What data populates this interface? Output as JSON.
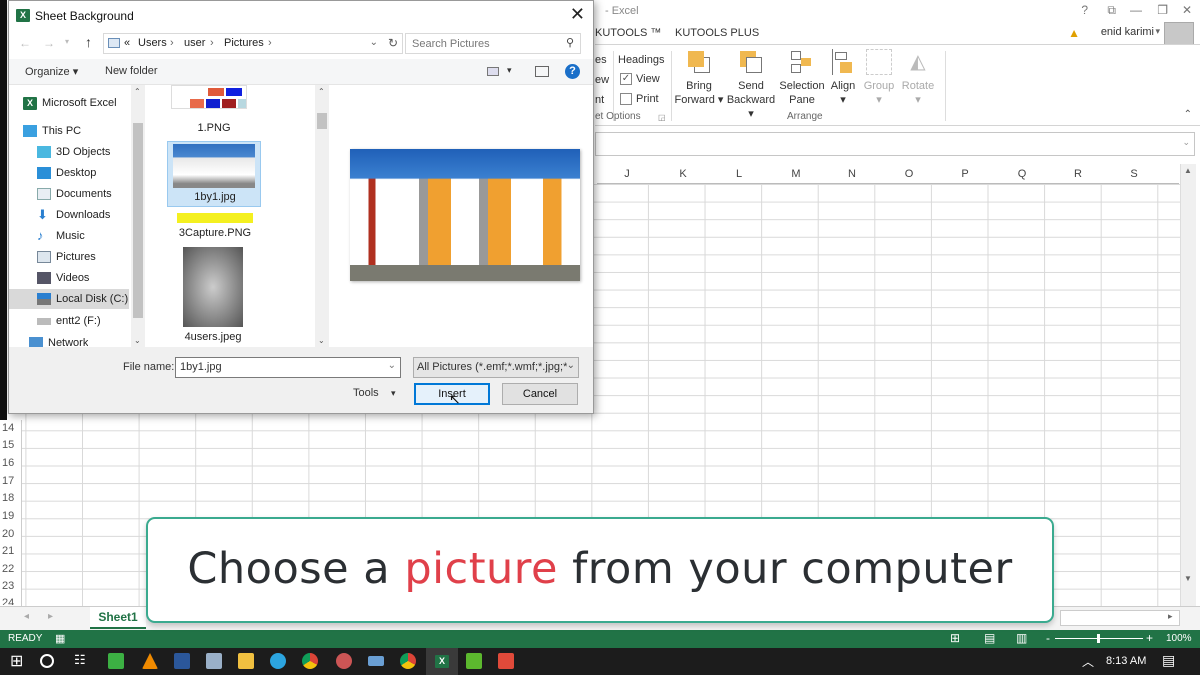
{
  "excel": {
    "window_title": "- Excel",
    "window_controls": [
      "?",
      "⧉",
      "—",
      "❐",
      "✕"
    ],
    "tabs": [
      "KUTOOLS ™",
      "KUTOOLS PLUS"
    ],
    "user": "enid karimi",
    "ribbon": {
      "sheet_options_partial": [
        "es",
        "ew",
        "nt"
      ],
      "headings_label": "Headings",
      "view_label": "View",
      "view_checked": true,
      "print_label": "Print",
      "print_checked": false,
      "sheet_options_group": "et Options",
      "arrange_group": "Arrange",
      "buttons": [
        {
          "line1": "Bring",
          "line2": "Forward ▾",
          "enabled": true
        },
        {
          "line1": "Send",
          "line2": "Backward ▾",
          "enabled": true
        },
        {
          "line1": "Selection",
          "line2": "Pane",
          "enabled": true
        },
        {
          "line1": "Align",
          "line2": "▾",
          "enabled": true
        },
        {
          "line1": "Group",
          "line2": "▾",
          "enabled": false
        },
        {
          "line1": "Rotate",
          "line2": "▾",
          "enabled": false
        }
      ]
    },
    "columns": [
      "J",
      "K",
      "L",
      "M",
      "N",
      "O",
      "P",
      "Q",
      "R",
      "S"
    ],
    "rows": [
      "14",
      "15",
      "16",
      "17",
      "18",
      "19",
      "20",
      "21",
      "22",
      "23",
      "24"
    ],
    "sheet_tab": "Sheet1",
    "status": "READY",
    "zoom": "100%",
    "zoom_level_percent": 100
  },
  "dialog": {
    "title": "Sheet Background",
    "breadcrumb": [
      "«",
      "Users",
      "›",
      "user",
      "›",
      "Pictures",
      "›"
    ],
    "search_placeholder": "Search Pictures",
    "organize": "Organize ▾",
    "new_folder": "New folder",
    "nav_items": [
      {
        "label": "Microsoft Excel",
        "icon": "excel-icon"
      },
      {
        "label": "This PC",
        "icon": "pc-icon"
      },
      {
        "label": "3D Objects",
        "icon": "cube-icon"
      },
      {
        "label": "Desktop",
        "icon": "desktop-icon"
      },
      {
        "label": "Documents",
        "icon": "document-icon"
      },
      {
        "label": "Downloads",
        "icon": "download-icon"
      },
      {
        "label": "Music",
        "icon": "music-icon"
      },
      {
        "label": "Pictures",
        "icon": "pictures-icon"
      },
      {
        "label": "Videos",
        "icon": "videos-icon"
      },
      {
        "label": "Local Disk (C:)",
        "icon": "disk-icon",
        "selected": true
      },
      {
        "label": "entt2 (F:)",
        "icon": "drive-icon"
      },
      {
        "label": "Network",
        "icon": "network-icon"
      }
    ],
    "files": [
      {
        "name": "1.PNG"
      },
      {
        "name": "1by1.jpg",
        "selected": true
      },
      {
        "name": "3Capture.PNG"
      },
      {
        "name": "4users.jpeg"
      }
    ],
    "file_name_label": "File name:",
    "file_name_value": "1by1.jpg",
    "file_type": "All Pictures (*.emf;*.wmf;*.jpg;*",
    "tools": "Tools",
    "insert": "Insert",
    "cancel": "Cancel"
  },
  "caption": {
    "before": "Choose a ",
    "highlight": "picture",
    "after": " from your computer",
    "highlight_color": "#e0404a",
    "border_color": "#3aaa8f"
  },
  "taskbar": {
    "time": "8:13 AM",
    "apps": [
      "start",
      "cortana",
      "task-view",
      "green-app",
      "vlc",
      "word",
      "notepad",
      "file-explorer",
      "telegram",
      "chrome",
      "paint",
      "keyboard",
      "chrome-2",
      "excel",
      "camtasia-green",
      "camtasia-red"
    ]
  }
}
